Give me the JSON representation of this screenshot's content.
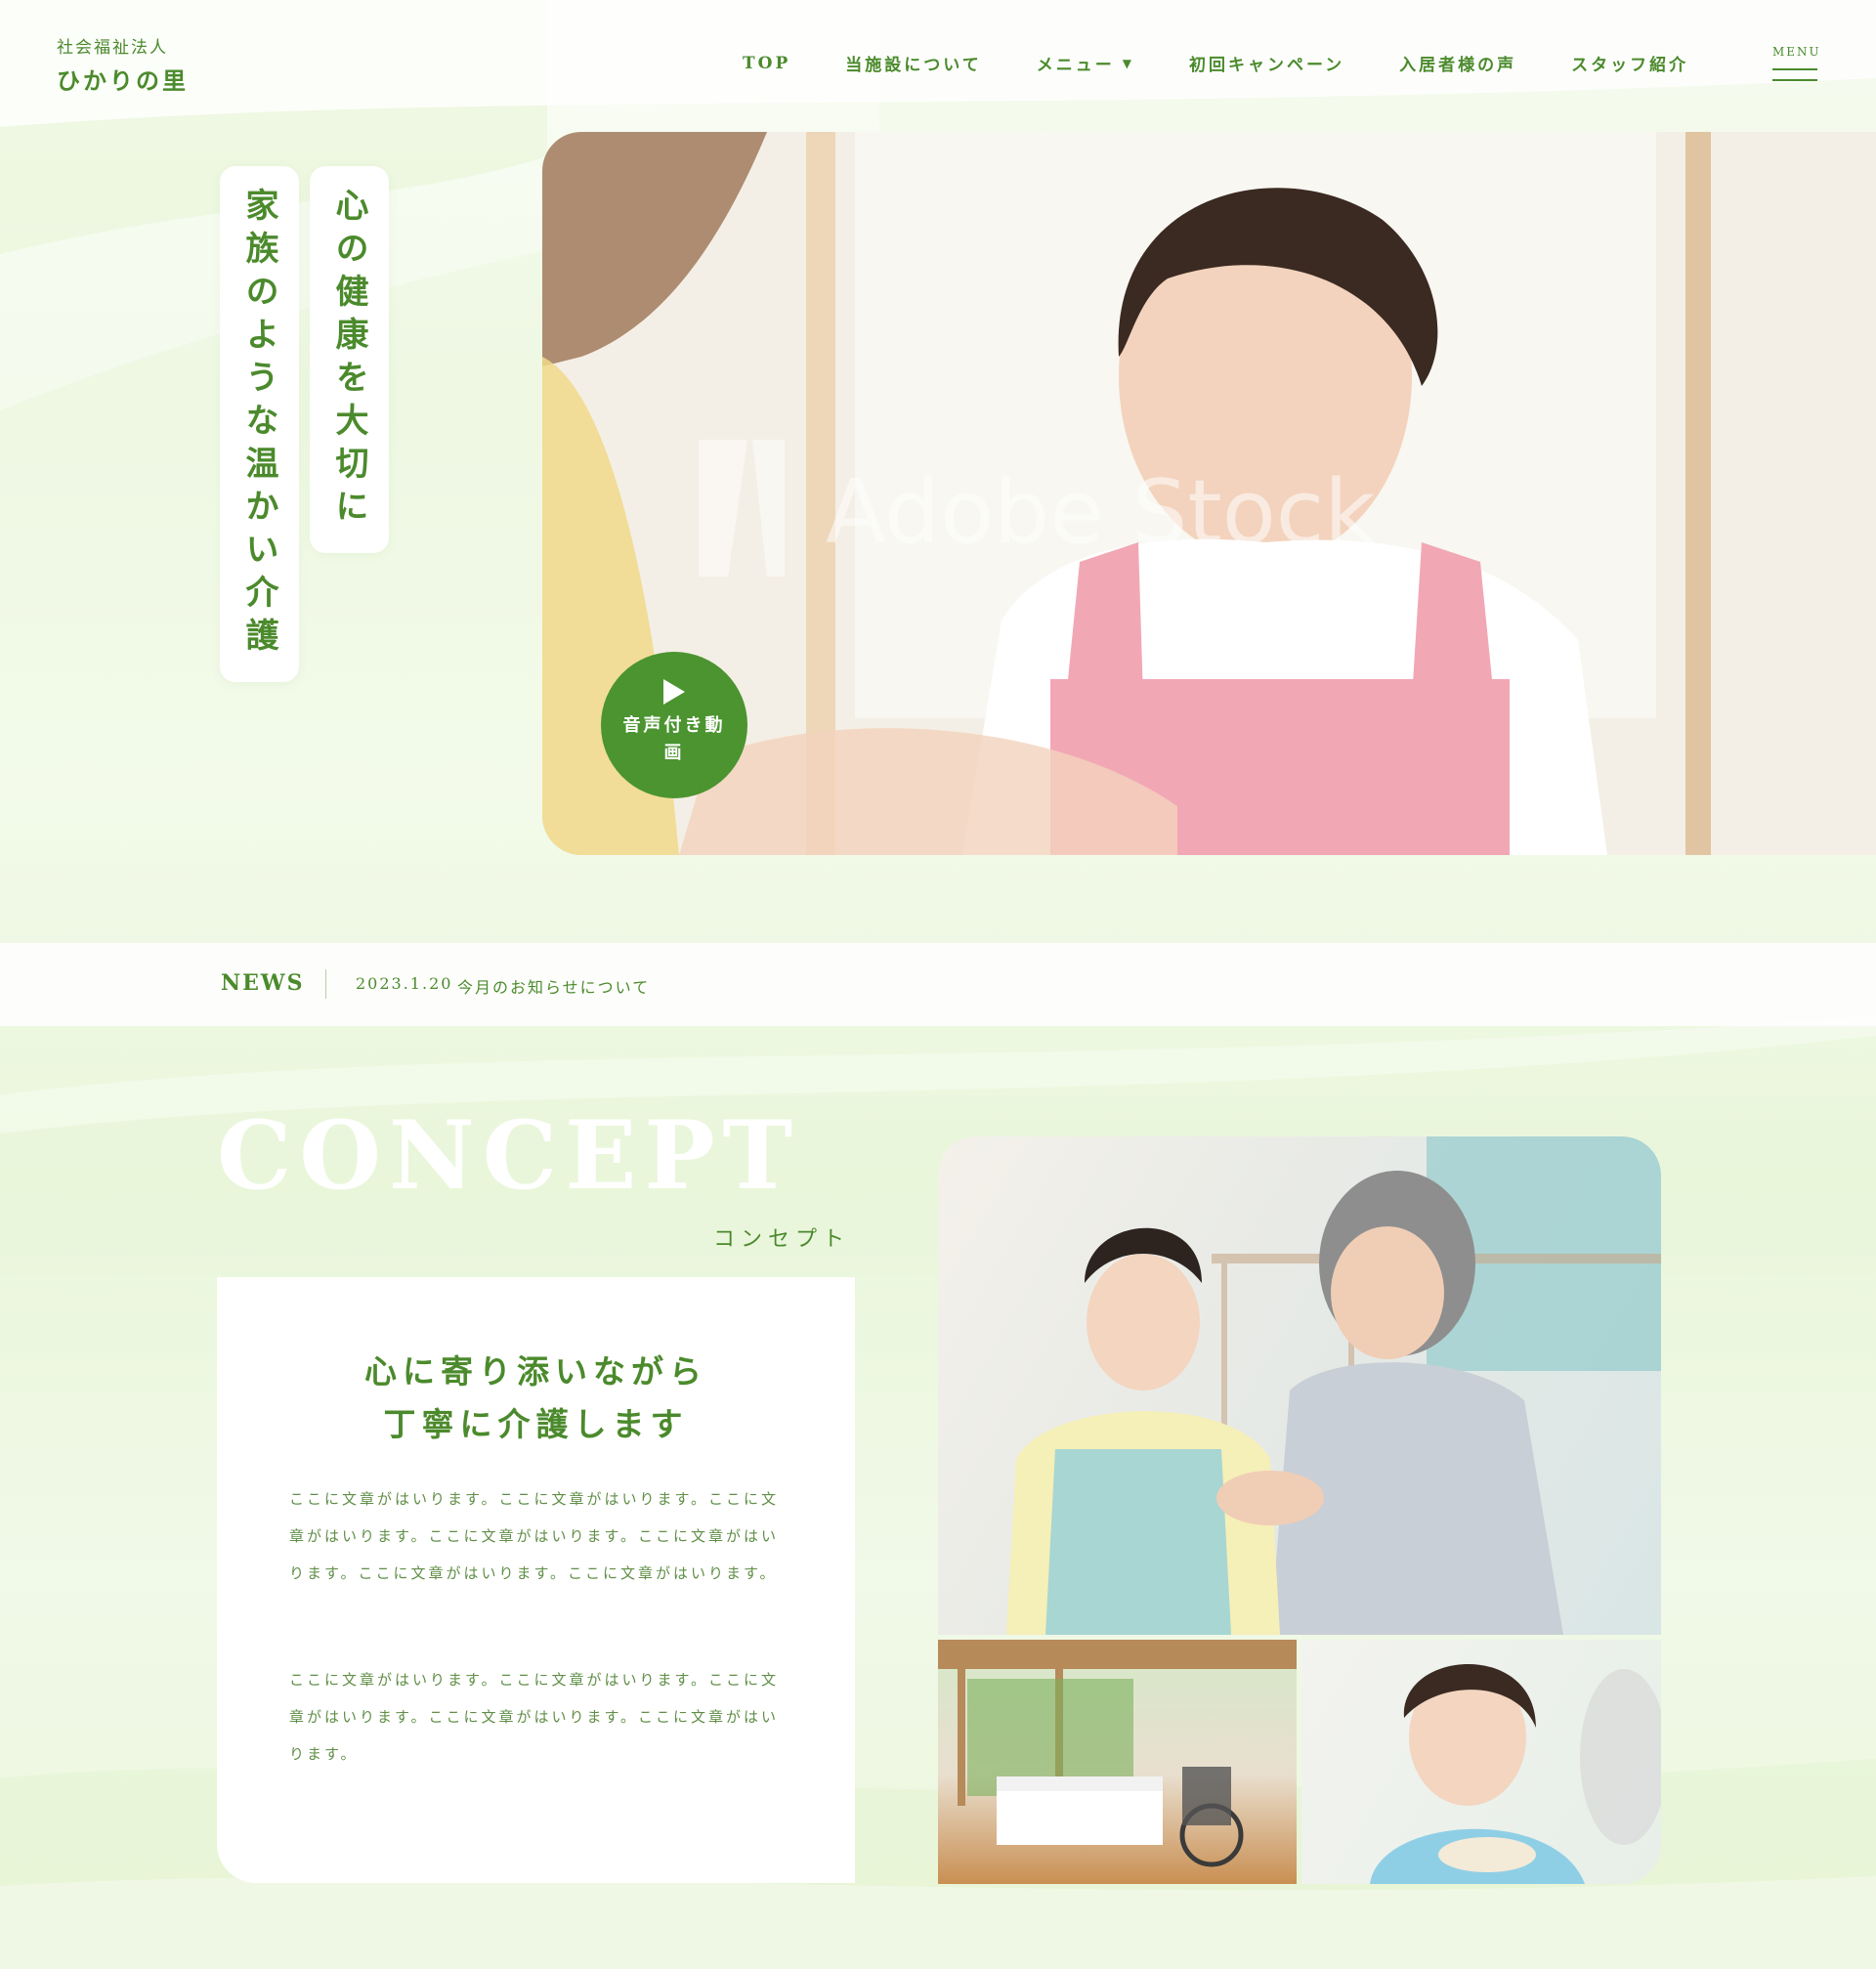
{
  "header": {
    "logo_sub": "社会福祉法人",
    "logo_main": "ひかりの里",
    "nav": [
      "TOP",
      "当施設について",
      "メニュー",
      "初回キャンペーン",
      "入居者様の声",
      "スタッフ紹介"
    ],
    "menu_label": "MENU"
  },
  "hero": {
    "copy_line1": "心の健康を大切に",
    "copy_line2": "家族のような温かい介護",
    "watermark": "Adobe Stock",
    "play_label": "音声付き動画"
  },
  "news": {
    "label": "NEWS",
    "date": "2023.1.20",
    "title": "今月のお知らせについて"
  },
  "concept": {
    "heading_en": "CONCEPT",
    "heading_ja": "コンセプト",
    "card_head_line1": "心に寄り添いながら",
    "card_head_line2": "丁寧に介護します",
    "para1": "ここに文章がはいります。ここに文章がはいります。ここに文章がはいります。ここに文章がはいります。ここに文章がはいります。ここに文章がはいります。ここに文章がはいります。",
    "para2": "ここに文章がはいります。ここに文章がはいります。ここに文章がはいります。ここに文章がはいります。ここに文章がはいります。"
  },
  "colors": {
    "accent": "#4b8a2c",
    "play_button": "#4b9430",
    "background": "#eef8e2"
  },
  "icons": [
    "play-icon",
    "chevron-down-icon",
    "hamburger-icon"
  ]
}
